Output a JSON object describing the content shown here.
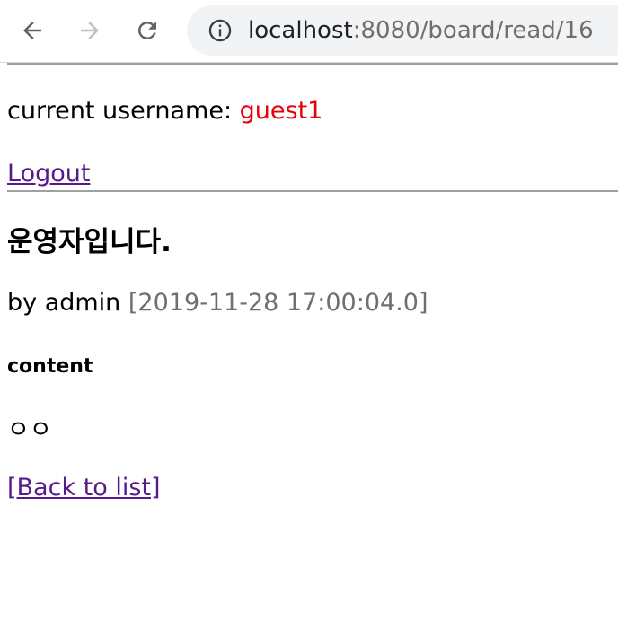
{
  "browser": {
    "url_host": "localhost",
    "url_path": ":8080/board/read/16"
  },
  "session": {
    "label": "current username: ",
    "username": "guest1",
    "logout_label": "Logout"
  },
  "post": {
    "title": "운영자입니다.",
    "by_label": "by admin ",
    "date": "[2019-11-28 17:00:04.0]",
    "content_heading": "content",
    "body": "ㅇㅇ"
  },
  "nav": {
    "back_to_list_label": "[Back to list]"
  },
  "colors": {
    "username": "#e8000b",
    "link": "#551a8b",
    "muted": "#6f6f6f"
  }
}
